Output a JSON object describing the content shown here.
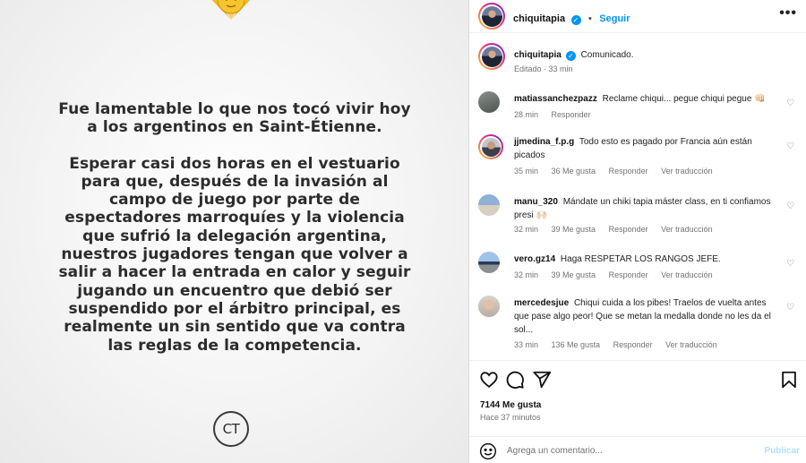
{
  "post_image": {
    "statement_paragraphs": [
      "Fue lamentable lo que nos tocó vivir hoy a los argentinos en Saint-Étienne.",
      "Esperar casi dos horas en el vestuario para que, después de la invasión al campo de juego por parte de espectadores marroquíes y la violencia que sufrió la delegación argentina, nuestros jugadores tengan que volver a salir a hacer la entrada en calor y seguir jugando un encuentro que debió ser suspendido por el árbitro principal, es realmente un sin sentido que va contra las reglas de la competencia."
    ],
    "logo_text": "CT"
  },
  "header": {
    "username": "chiquitapia",
    "separator": "•",
    "follow_label": "Seguir",
    "more_label": "•••"
  },
  "caption": {
    "username": "chiquitapia",
    "text": "Comunicado.",
    "meta": "Editado · 33 min"
  },
  "comments": [
    {
      "username": "matiassanchezpazz",
      "text": "Reclame chiqui... pegue chiqui pegue 👊🏻",
      "time": "28 min",
      "likes": "",
      "reply": "Responder",
      "translate": ""
    },
    {
      "username": "jjmedina_f.p.g",
      "text": "Todo esto es pagado por Francia aún están picados",
      "time": "35 min",
      "likes": "36 Me gusta",
      "reply": "Responder",
      "translate": "Ver traducción"
    },
    {
      "username": "manu_320",
      "text": "Mándate un chiki tapia máster class, en ti confiamos presi 🙌🏻",
      "time": "32 min",
      "likes": "39 Me gusta",
      "reply": "Responder",
      "translate": "Ver traducción"
    },
    {
      "username": "vero.gz14",
      "text": "Haga RESPETAR LOS RANGOS JEFE.",
      "time": "32 min",
      "likes": "39 Me gusta",
      "reply": "Responder",
      "translate": "Ver traducción"
    },
    {
      "username": "mercedesjue",
      "text": "Chiqui cuida a los pibes! Traelos de vuelta antes que pase algo peor! Que se metan la medalla donde no les da el sol...",
      "time": "33 min",
      "likes": "136 Me gusta",
      "reply": "Responder",
      "translate": "Ver traducción"
    }
  ],
  "actions": {
    "likes_count": "7144 Me gusta",
    "time_ago": "Hace 37 minutos"
  },
  "composer": {
    "placeholder": "Agrega un comentario...",
    "post_label": "Publicar"
  },
  "colors": {
    "accent": "#0095f6",
    "muted": "#737373",
    "post_disabled": "#b2dffc"
  }
}
